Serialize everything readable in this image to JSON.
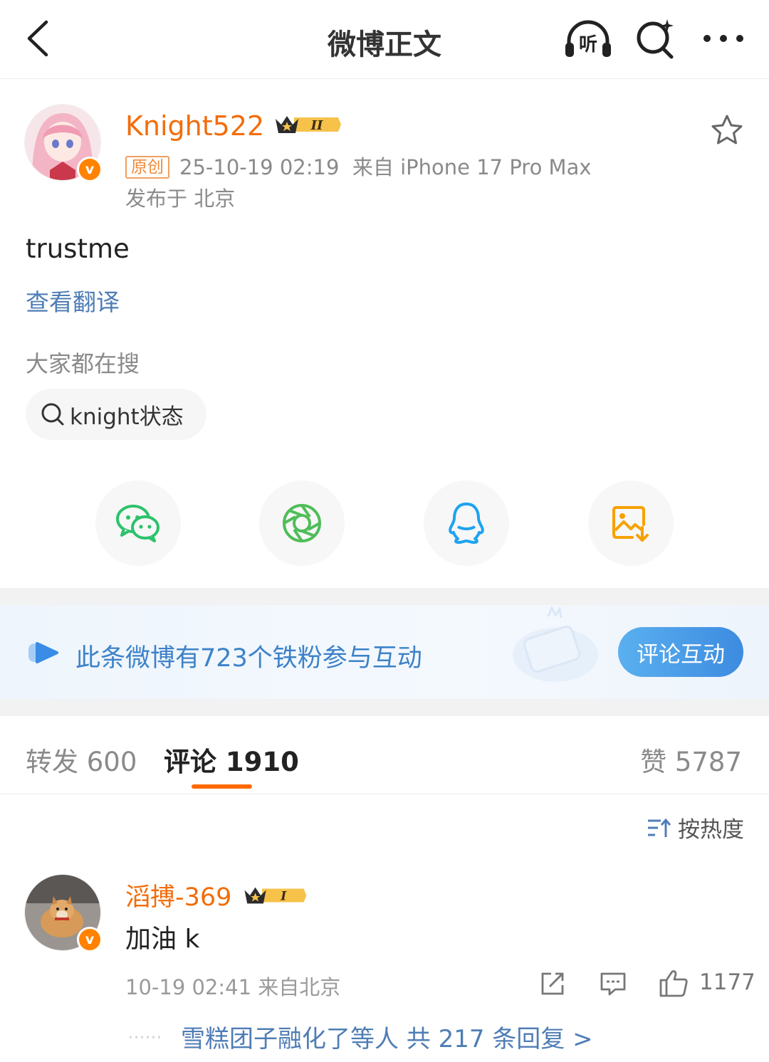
{
  "nav": {
    "title": "微博正文",
    "listen_label": "听"
  },
  "post": {
    "username": "Knight522",
    "badge_level": "II",
    "original_tag": "原创",
    "timestamp": "25-10-19 02:19",
    "source": "来自 iPhone 17 Pro Max",
    "location": "发布于 北京",
    "text": "trustme",
    "translate_label": "查看翻译",
    "search_section_label": "大家都在搜",
    "search_chip": "knight状态"
  },
  "share": {
    "items": [
      {
        "name": "wechat-icon",
        "color": "#2dc26b"
      },
      {
        "name": "moments-icon",
        "color": "#4fbd58"
      },
      {
        "name": "qq-icon",
        "color": "#1ea2f0"
      },
      {
        "name": "save-image-icon",
        "color": "#f7a100"
      }
    ]
  },
  "banner": {
    "text": "此条微博有723个铁粉参与互动",
    "button": "评论互动"
  },
  "tabs": {
    "repost": "转发 600",
    "comment": "评论 1910",
    "like": "赞 5787"
  },
  "sort_label": "按热度",
  "comment": {
    "username": "滔搏-369",
    "badge_level": "I",
    "text": "加油 k",
    "meta": "10-19 02:41 来自北京",
    "likes": "1177",
    "reply_prefix": "······",
    "reply_text": "雪糕团子融化了等人  共 217 条回复 >"
  },
  "colors": {
    "accent_orange": "#ff8200",
    "link_blue": "#4f7db5",
    "tab_indicator": "#ff6a00"
  }
}
